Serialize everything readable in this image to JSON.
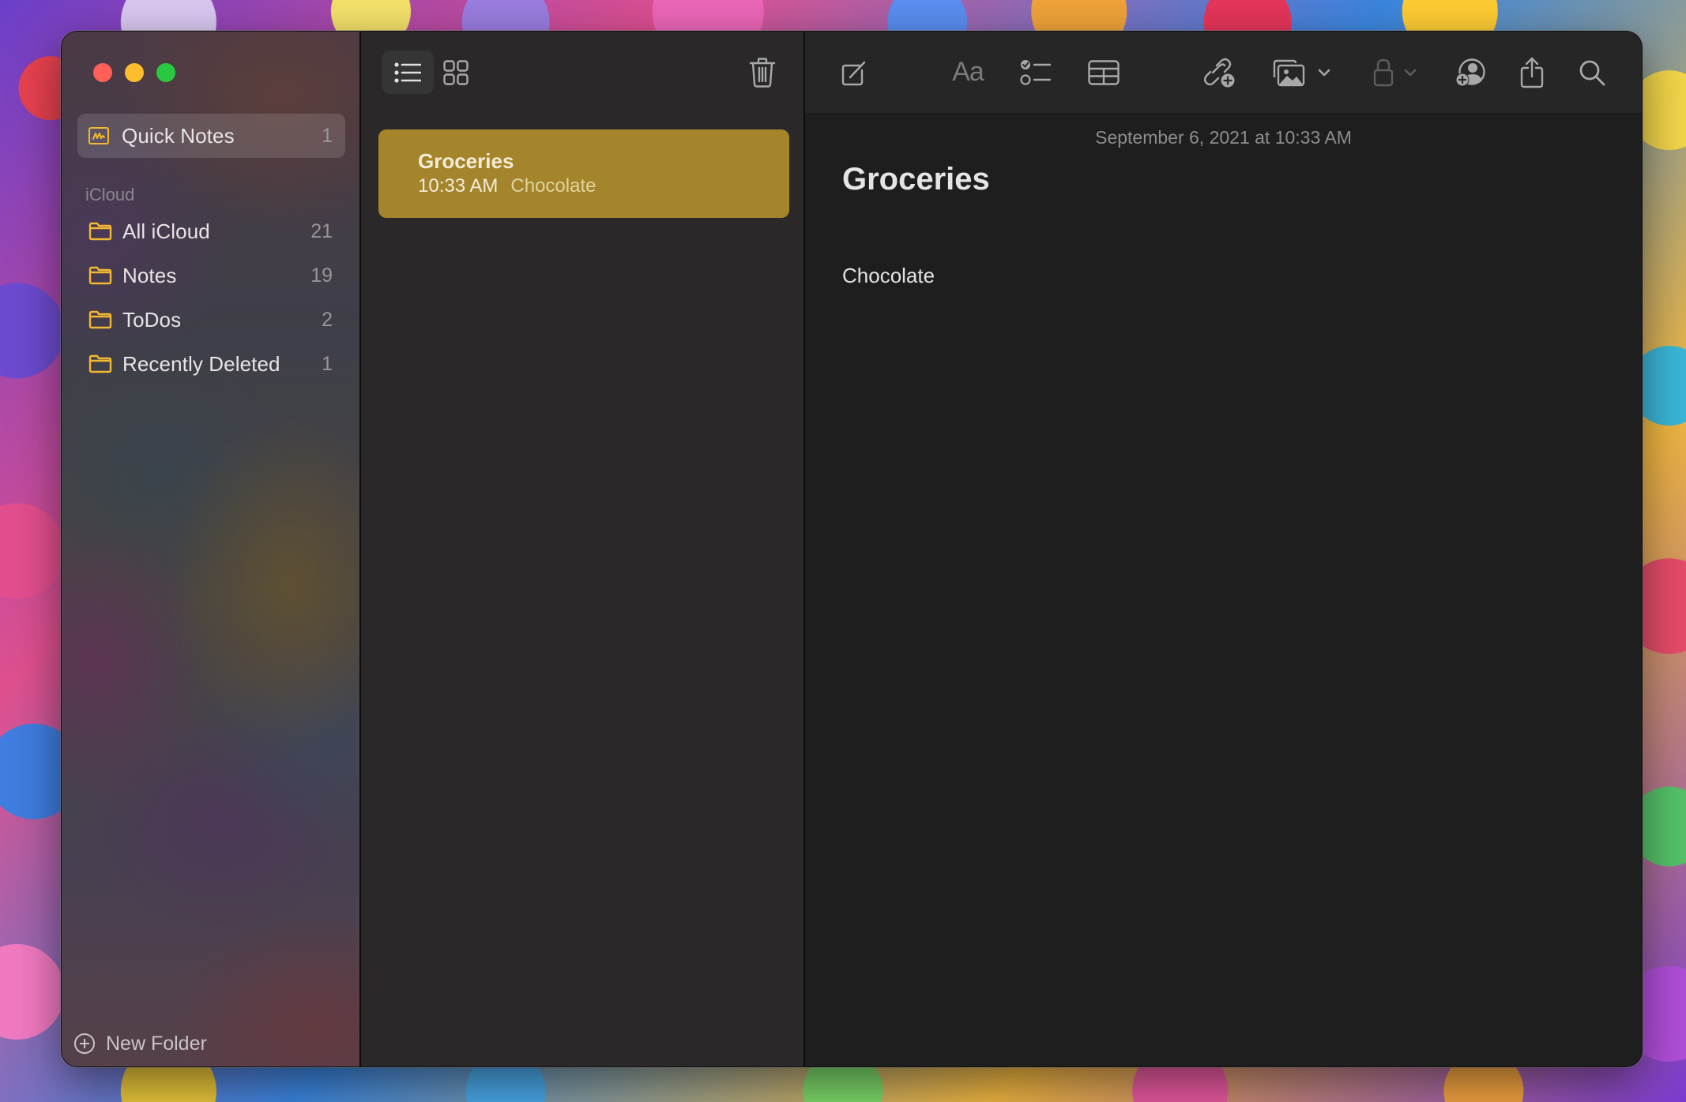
{
  "window": {
    "traffic_lights": [
      "close",
      "minimize",
      "maximize"
    ]
  },
  "sidebar": {
    "pinned": {
      "label": "Quick Notes",
      "count": "1",
      "icon": "quick-note-icon"
    },
    "section_header": "iCloud",
    "folders": [
      {
        "label": "All iCloud",
        "count": "21",
        "icon": "folder-icon"
      },
      {
        "label": "Notes",
        "count": "19",
        "icon": "folder-icon"
      },
      {
        "label": "ToDos",
        "count": "2",
        "icon": "folder-icon"
      },
      {
        "label": "Recently Deleted",
        "count": "1",
        "icon": "folder-icon"
      }
    ],
    "new_folder_label": "New Folder"
  },
  "note_list": {
    "toolbar": {
      "list_view": "list-view-icon",
      "gallery_view": "gallery-view-icon",
      "delete": "trash-icon"
    },
    "notes": [
      {
        "title": "Groceries",
        "time": "10:33 AM",
        "preview": "Chocolate",
        "selected": true
      }
    ]
  },
  "editor": {
    "toolbar": {
      "compose": "compose-icon",
      "format": "Aa",
      "checklist": "checklist-icon",
      "table": "table-icon",
      "link": "add-link-icon",
      "media": "media-icon",
      "lock": "lock-icon",
      "collaborate": "collaborate-icon",
      "share": "share-icon",
      "search": "search-icon"
    },
    "date": "September 6, 2021 at 10:33 AM",
    "title": "Groceries",
    "body": "Chocolate"
  },
  "colors": {
    "accent": "#f4b931",
    "selected_note": "#a4852b",
    "list_bg": "#2a2829",
    "editor_bg": "#1e1e1e",
    "toolbar_bg": "#272627"
  }
}
